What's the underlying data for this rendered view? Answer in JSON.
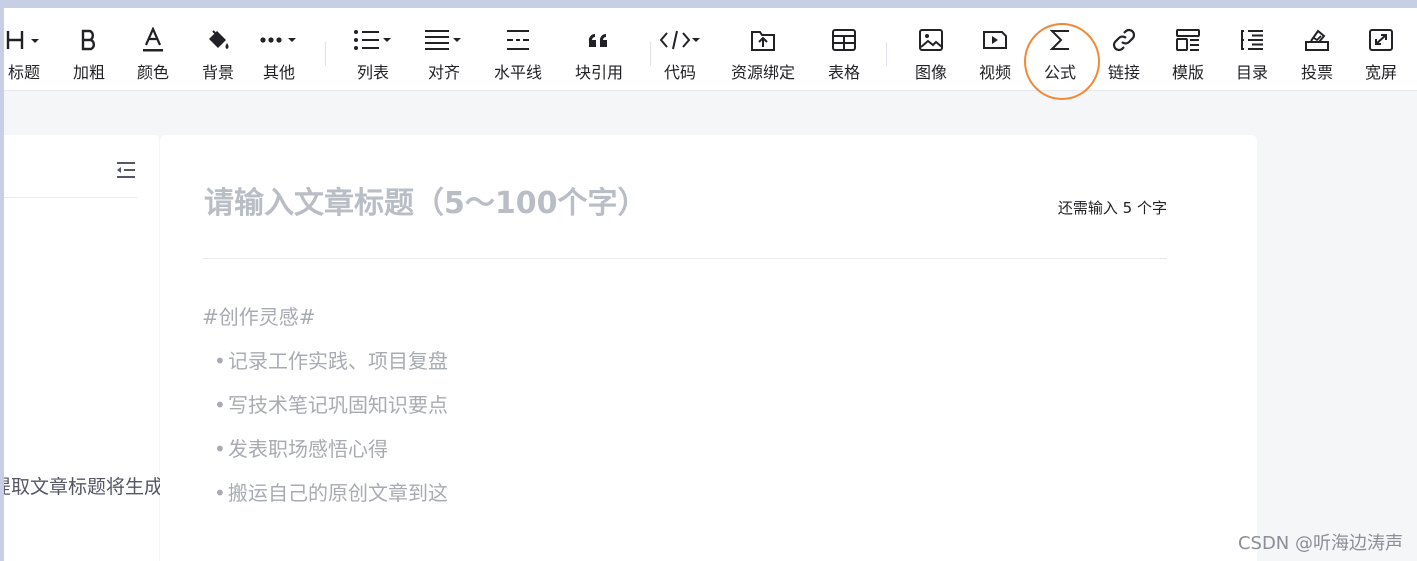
{
  "toolbar": {
    "items": [
      {
        "label": "标题",
        "icon": "heading-icon",
        "dropdown": true
      },
      {
        "label": "加粗",
        "icon": "bold-icon"
      },
      {
        "label": "颜色",
        "icon": "font-color-icon"
      },
      {
        "label": "背景",
        "icon": "paint-bucket-icon"
      },
      {
        "label": "其他",
        "icon": "more-icon",
        "dropdown": true
      },
      {
        "label": "列表",
        "icon": "list-icon",
        "dropdown": true
      },
      {
        "label": "对齐",
        "icon": "align-icon",
        "dropdown": true
      },
      {
        "label": "水平线",
        "icon": "horizontal-rule-icon"
      },
      {
        "label": "块引用",
        "icon": "quote-icon"
      },
      {
        "label": "代码",
        "icon": "code-icon",
        "dropdown": true
      },
      {
        "label": "资源绑定",
        "icon": "resource-upload-icon"
      },
      {
        "label": "表格",
        "icon": "table-icon"
      },
      {
        "label": "图像",
        "icon": "image-icon"
      },
      {
        "label": "视频",
        "icon": "video-icon"
      },
      {
        "label": "公式",
        "icon": "sigma-icon",
        "highlighted": true
      },
      {
        "label": "链接",
        "icon": "link-icon"
      },
      {
        "label": "模版",
        "icon": "template-icon"
      },
      {
        "label": "目录",
        "icon": "toc-icon"
      },
      {
        "label": "投票",
        "icon": "vote-icon"
      },
      {
        "label": "宽屏",
        "icon": "widescreen-icon"
      }
    ],
    "highlight_color": "#f08a3a"
  },
  "sidebar": {
    "hint": "提取文章标题将生成目录"
  },
  "editor": {
    "title_placeholder": "请输入文章标题（5～100个字）",
    "char_hint": "还需输入 5 个字",
    "body_hint": {
      "tag": "#创作灵感#",
      "items": [
        "记录工作实践、项目复盘",
        "写技术笔记巩固知识要点",
        "发表职场感悟心得",
        "搬运自己的原创文章到这"
      ]
    }
  },
  "watermark": "CSDN @听海边涛声"
}
